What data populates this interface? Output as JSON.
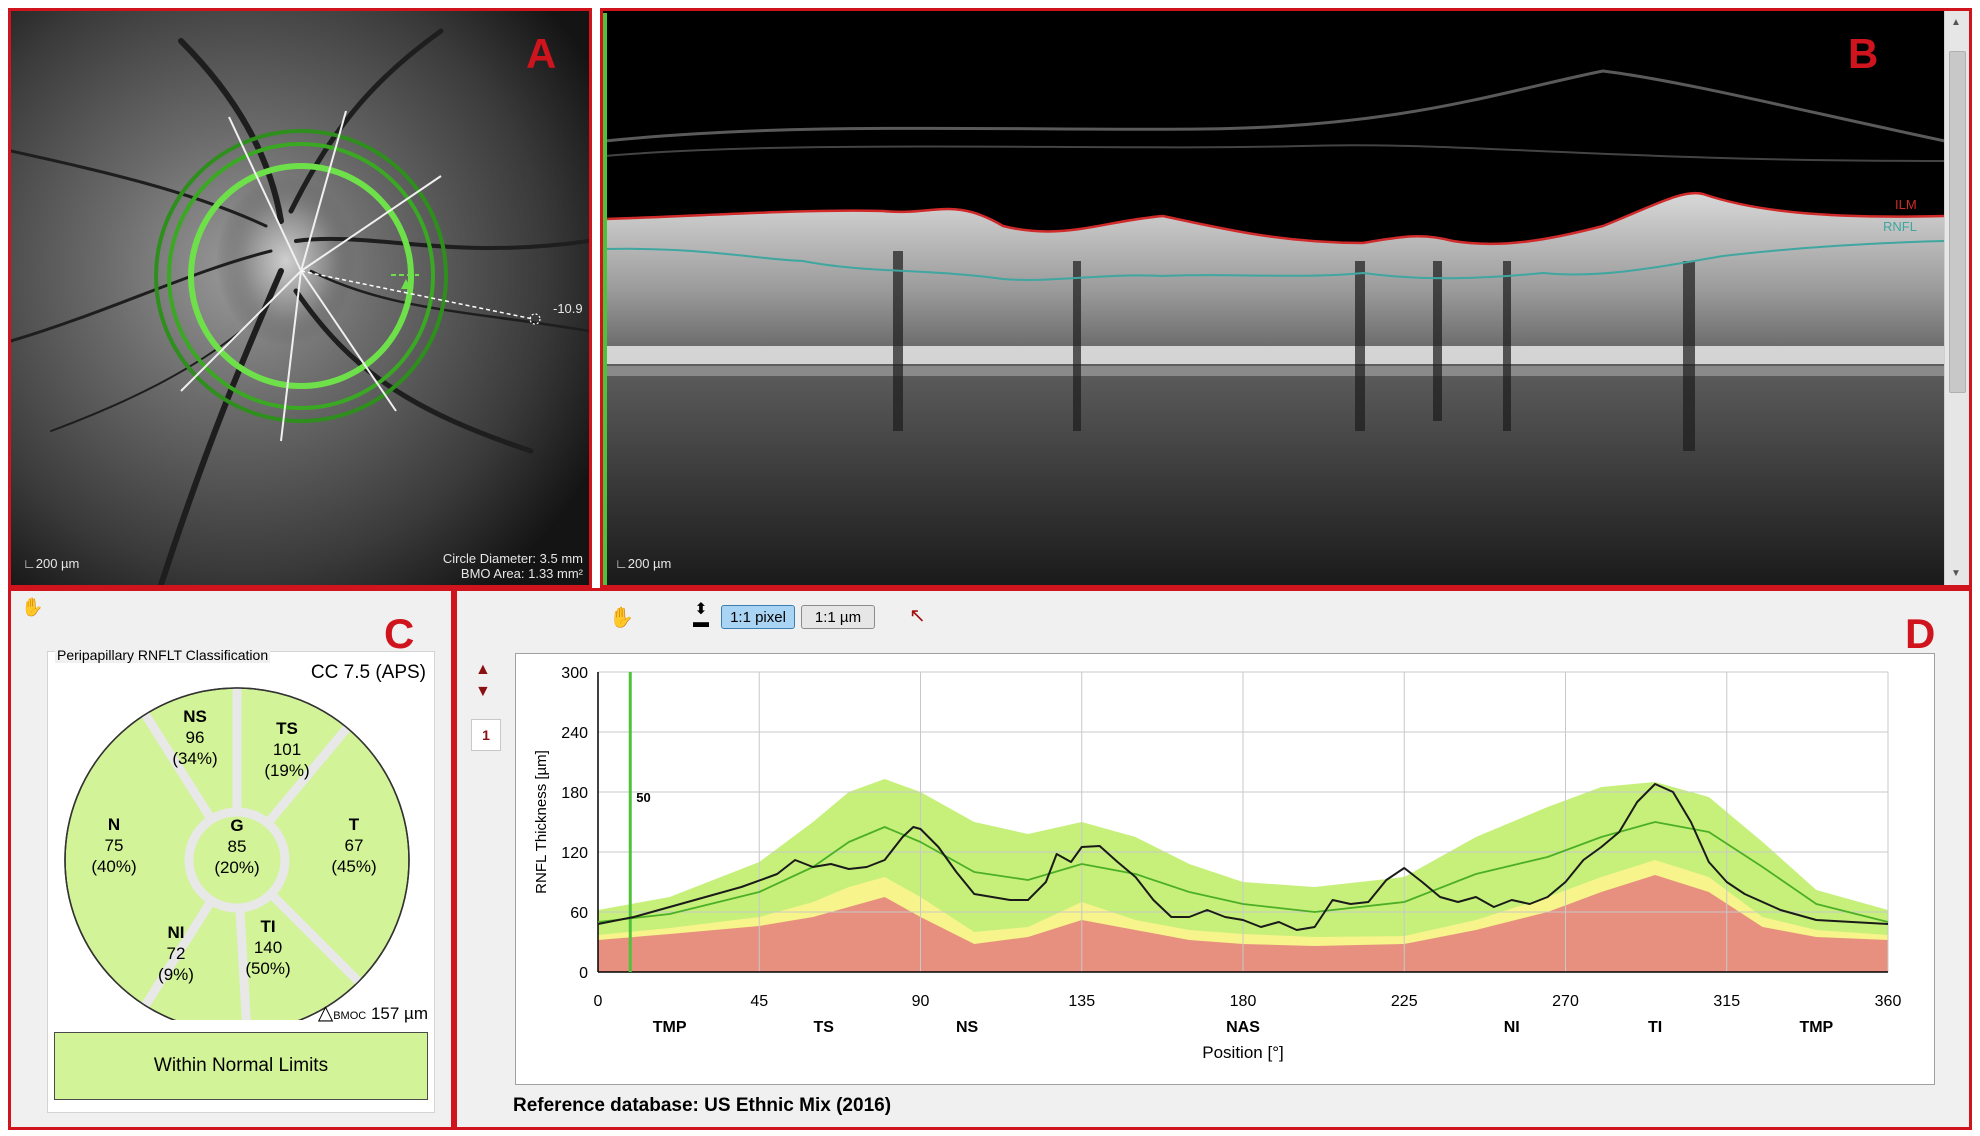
{
  "panels": {
    "a": {
      "letter": "A",
      "offset_value": "-10.9",
      "scale_label": "200 µm",
      "circle_diameter": "Circle Diameter: 3.5 mm",
      "bmo_area": "BMO Area: 1.33 mm²"
    },
    "b": {
      "letter": "B",
      "ilm_label": "ILM",
      "rnfl_label": "RNFL",
      "scale_label": "200 µm"
    },
    "c": {
      "letter": "C",
      "title": "Peripapillary RNFLT Classification",
      "cc": "CC 7.5 (APS)",
      "sectors": {
        "ns": {
          "name": "NS",
          "value": "96",
          "pct": "(34%)"
        },
        "ts": {
          "name": "TS",
          "value": "101",
          "pct": "(19%)"
        },
        "n": {
          "name": "N",
          "value": "75",
          "pct": "(40%)"
        },
        "g": {
          "name": "G",
          "value": "85",
          "pct": "(20%)"
        },
        "t": {
          "name": "T",
          "value": "67",
          "pct": "(45%)"
        },
        "ni": {
          "name": "NI",
          "value": "72",
          "pct": "(9%)"
        },
        "ti": {
          "name": "TI",
          "value": "140",
          "pct": "(50%)"
        }
      },
      "bmoc_symbol": "△",
      "bmoc_label": "BMOC",
      "bmoc_value": "157 µm",
      "classification": "Within Normal Limits",
      "sector_fill": "#d2f398"
    },
    "d": {
      "letter": "D",
      "toolbar": {
        "pixel_button": "1:1 pixel",
        "um_button": "1:1 µm",
        "hand_icon": "hand-icon",
        "fit_icon": "fit-height-icon",
        "pointer_icon": "pointer-icon"
      },
      "page_badge": "1",
      "reference": "Reference database: US Ethnic Mix (2016)"
    }
  },
  "chart_data": {
    "type": "line",
    "xlabel": "Position [°]",
    "ylabel": "RNFL Thickness  [µm]",
    "xlim": [
      0,
      360
    ],
    "ylim": [
      0,
      300
    ],
    "x_ticks": [
      0,
      45,
      90,
      135,
      180,
      225,
      270,
      315,
      360
    ],
    "y_ticks": [
      0,
      60,
      120,
      180,
      240,
      300
    ],
    "sector_labels": [
      {
        "label": "TMP",
        "x": 20
      },
      {
        "label": "TS",
        "x": 63
      },
      {
        "label": "NS",
        "x": 103
      },
      {
        "label": "NAS",
        "x": 180
      },
      {
        "label": "NI",
        "x": 255
      },
      {
        "label": "TI",
        "x": 295
      },
      {
        "label": "TMP",
        "x": 340
      }
    ],
    "marker": {
      "x": 9,
      "label": "50"
    },
    "normal_upper": {
      "x": [
        0,
        20,
        45,
        60,
        70,
        80,
        90,
        105,
        120,
        135,
        150,
        165,
        180,
        200,
        225,
        245,
        265,
        280,
        295,
        310,
        325,
        340,
        360
      ],
      "y": [
        62,
        75,
        110,
        150,
        180,
        193,
        180,
        150,
        138,
        150,
        135,
        108,
        90,
        85,
        95,
        135,
        165,
        185,
        190,
        175,
        130,
        82,
        62
      ]
    },
    "borderline_upper": {
      "x": [
        0,
        20,
        45,
        60,
        70,
        80,
        90,
        105,
        120,
        135,
        150,
        165,
        180,
        200,
        225,
        245,
        265,
        280,
        295,
        310,
        325,
        340,
        360
      ],
      "y": [
        37,
        44,
        55,
        70,
        85,
        95,
        75,
        40,
        45,
        70,
        52,
        42,
        38,
        35,
        36,
        52,
        75,
        95,
        112,
        95,
        55,
        42,
        37
      ]
    },
    "outside_upper": {
      "x": [
        0,
        20,
        45,
        60,
        70,
        80,
        90,
        105,
        120,
        135,
        150,
        165,
        180,
        200,
        225,
        245,
        265,
        280,
        295,
        310,
        325,
        340,
        360
      ],
      "y": [
        32,
        38,
        46,
        55,
        65,
        75,
        55,
        28,
        35,
        52,
        42,
        32,
        28,
        26,
        28,
        42,
        60,
        80,
        97,
        80,
        45,
        35,
        32
      ]
    },
    "series": [
      {
        "name": "",
        "color": "#1a1a1a",
        "x": [
          0,
          10,
          20,
          30,
          40,
          50,
          55,
          60,
          65,
          70,
          75,
          80,
          85,
          88,
          90,
          95,
          100,
          105,
          110,
          115,
          120,
          125,
          128,
          132,
          135,
          140,
          145,
          150,
          155,
          160,
          165,
          170,
          175,
          180,
          185,
          190,
          195,
          200,
          205,
          210,
          215,
          220,
          225,
          230,
          235,
          240,
          245,
          250,
          255,
          260,
          265,
          270,
          275,
          280,
          285,
          290,
          295,
          300,
          305,
          310,
          315,
          320,
          330,
          340,
          350,
          360
        ],
        "y": [
          48,
          55,
          65,
          75,
          85,
          98,
          112,
          105,
          108,
          103,
          105,
          112,
          135,
          145,
          143,
          125,
          100,
          78,
          75,
          72,
          72,
          90,
          118,
          110,
          125,
          126,
          110,
          95,
          72,
          55,
          55,
          62,
          55,
          52,
          45,
          50,
          42,
          45,
          72,
          68,
          70,
          92,
          104,
          90,
          75,
          70,
          75,
          65,
          72,
          68,
          75,
          90,
          112,
          125,
          140,
          170,
          188,
          180,
          150,
          110,
          90,
          78,
          62,
          52,
          50,
          48
        ]
      },
      {
        "name": "",
        "color": "#4caf26",
        "x": [
          0,
          20,
          45,
          60,
          70,
          80,
          90,
          105,
          120,
          135,
          150,
          165,
          180,
          200,
          225,
          245,
          265,
          280,
          295,
          310,
          325,
          340,
          360
        ],
        "y": [
          50,
          58,
          80,
          105,
          130,
          145,
          130,
          100,
          92,
          108,
          98,
          80,
          68,
          60,
          70,
          98,
          115,
          135,
          150,
          140,
          105,
          68,
          50
        ]
      }
    ]
  }
}
